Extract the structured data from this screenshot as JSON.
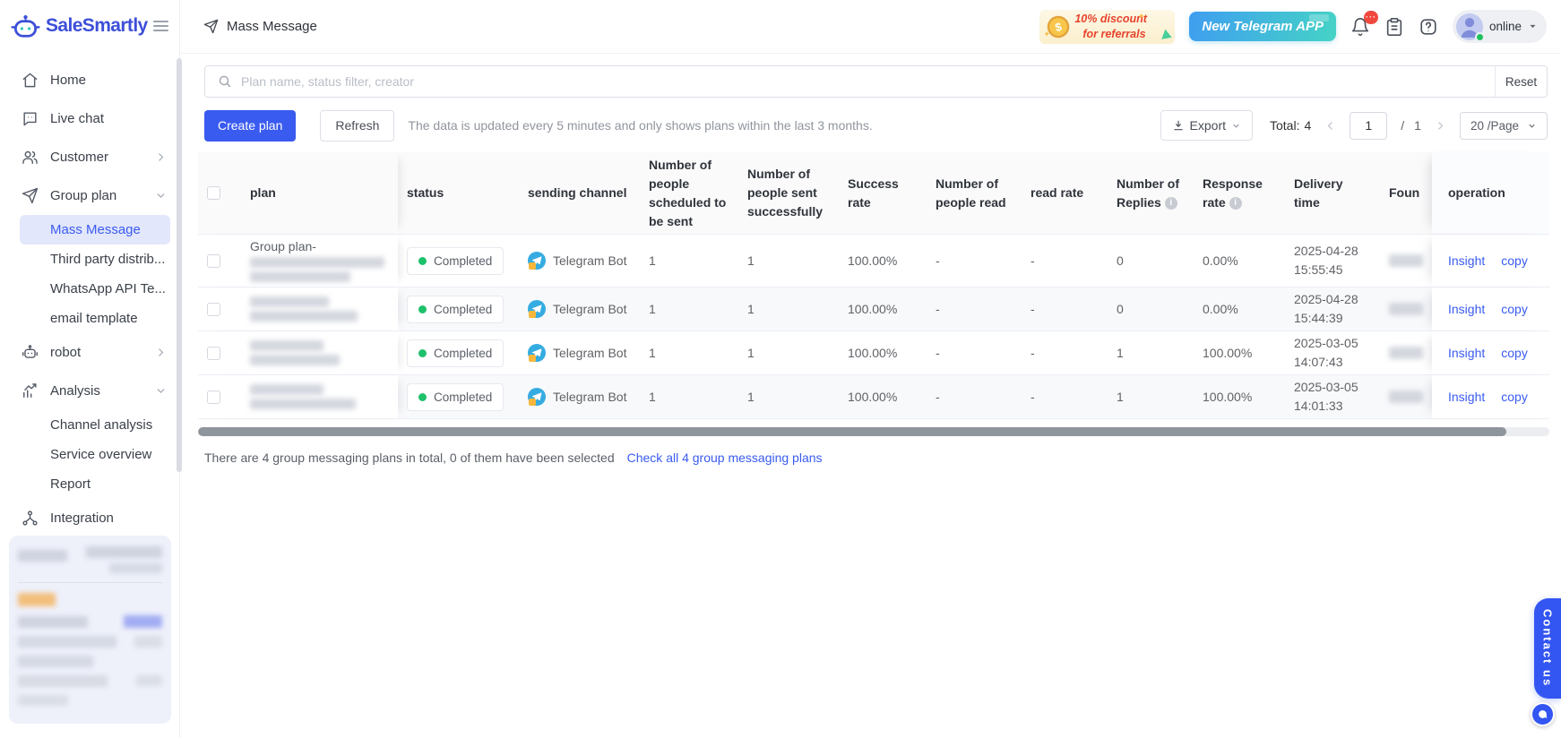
{
  "brand": {
    "name": "SaleSmartly"
  },
  "topbar": {
    "page_title": "Mass Message",
    "promo": {
      "line1": "10% discount",
      "line2": "for referrals"
    },
    "telegram_badge": "New Telegram APP",
    "notification_dots": "···",
    "presence": "online"
  },
  "sidebar": {
    "items": [
      {
        "id": "home",
        "label": "Home",
        "icon": "home"
      },
      {
        "id": "live-chat",
        "label": "Live chat",
        "icon": "chat"
      },
      {
        "id": "customer",
        "label": "Customer",
        "icon": "users",
        "chevron": "right"
      },
      {
        "id": "group-plan",
        "label": "Group plan",
        "icon": "send",
        "chevron": "down",
        "children": [
          {
            "id": "mass-message",
            "label": "Mass Message",
            "active": true
          },
          {
            "id": "third-party-distribution",
            "label": "Third party distrib..."
          },
          {
            "id": "whatsapp-api-template",
            "label": "WhatsApp API Te..."
          },
          {
            "id": "email-template",
            "label": "email template"
          }
        ]
      },
      {
        "id": "robot",
        "label": "robot",
        "icon": "robot",
        "chevron": "right"
      },
      {
        "id": "analysis",
        "label": "Analysis",
        "icon": "chart",
        "chevron": "down",
        "children": [
          {
            "id": "channel-analysis",
            "label": "Channel analysis"
          },
          {
            "id": "service-overview",
            "label": "Service overview"
          },
          {
            "id": "report",
            "label": "Report"
          }
        ]
      },
      {
        "id": "integration",
        "label": "Integration",
        "icon": "integration"
      }
    ]
  },
  "search": {
    "placeholder": "Plan name, status filter, creator",
    "reset": "Reset"
  },
  "toolbar": {
    "create": "Create plan",
    "refresh": "Refresh",
    "note": "The data is updated every 5 minutes and only shows plans within the last 3 months.",
    "export": "Export",
    "total_label": "Total:",
    "total": "4",
    "page": "1",
    "page_sep": "/",
    "pages": "1",
    "page_size": "20 /Page"
  },
  "table": {
    "columns": [
      {
        "key": "check",
        "label": ""
      },
      {
        "key": "plan",
        "label": "plan"
      },
      {
        "key": "status",
        "label": "status"
      },
      {
        "key": "channel",
        "label": "sending channel"
      },
      {
        "key": "scheduled",
        "label": "Number of people scheduled to be sent"
      },
      {
        "key": "sent",
        "label": "Number of people sent successfully"
      },
      {
        "key": "success_rate",
        "label": "Success rate"
      },
      {
        "key": "people_read",
        "label": "Number of people read"
      },
      {
        "key": "read_rate",
        "label": "read rate"
      },
      {
        "key": "replies",
        "label": "Number of Replies",
        "info": true
      },
      {
        "key": "response_rate",
        "label": "Response rate",
        "info": true
      },
      {
        "key": "delivery",
        "label": "Delivery time"
      },
      {
        "key": "founder",
        "label": "Foun"
      },
      {
        "key": "operation",
        "label": "operation"
      }
    ],
    "rows": [
      {
        "plan_text": "Group plan-",
        "status": "Completed",
        "channel": "Telegram Bot",
        "scheduled": "1",
        "sent": "1",
        "success_rate": "100.00%",
        "people_read": "-",
        "read_rate": "-",
        "replies": "0",
        "response_rate": "0.00%",
        "delivery_date": "2025-04-28",
        "delivery_time": "15:55:45",
        "actions": [
          "Insight",
          "copy"
        ]
      },
      {
        "plan_text": "",
        "status": "Completed",
        "channel": "Telegram Bot",
        "scheduled": "1",
        "sent": "1",
        "success_rate": "100.00%",
        "people_read": "-",
        "read_rate": "-",
        "replies": "0",
        "response_rate": "0.00%",
        "delivery_date": "2025-04-28",
        "delivery_time": "15:44:39",
        "actions": [
          "Insight",
          "copy"
        ]
      },
      {
        "plan_text": "",
        "status": "Completed",
        "channel": "Telegram Bot",
        "scheduled": "1",
        "sent": "1",
        "success_rate": "100.00%",
        "people_read": "-",
        "read_rate": "-",
        "replies": "1",
        "response_rate": "100.00%",
        "delivery_date": "2025-03-05",
        "delivery_time": "14:07:43",
        "actions": [
          "Insight",
          "copy"
        ]
      },
      {
        "plan_text": "",
        "status": "Completed",
        "channel": "Telegram Bot",
        "scheduled": "1",
        "sent": "1",
        "success_rate": "100.00%",
        "people_read": "-",
        "read_rate": "-",
        "replies": "1",
        "response_rate": "100.00%",
        "delivery_date": "2025-03-05",
        "delivery_time": "14:01:33",
        "actions": [
          "Insight",
          "copy"
        ]
      }
    ]
  },
  "footer": {
    "summary": "There are 4 group messaging plans in total, 0 of them have been selected",
    "check_all": "Check all 4 group messaging plans"
  },
  "contact": {
    "label": "Contact us"
  },
  "colors": {
    "accent": "#3a5bf0",
    "success_green": "#1ec16b",
    "link_blue": "#3a5bf0",
    "telegram_blue": "#35ace1",
    "notification_red": "#f0483e",
    "promo_text_red": "#e8432c",
    "badge_gradient_start": "#3f9ef0",
    "badge_gradient_end": "#45d3c6"
  }
}
